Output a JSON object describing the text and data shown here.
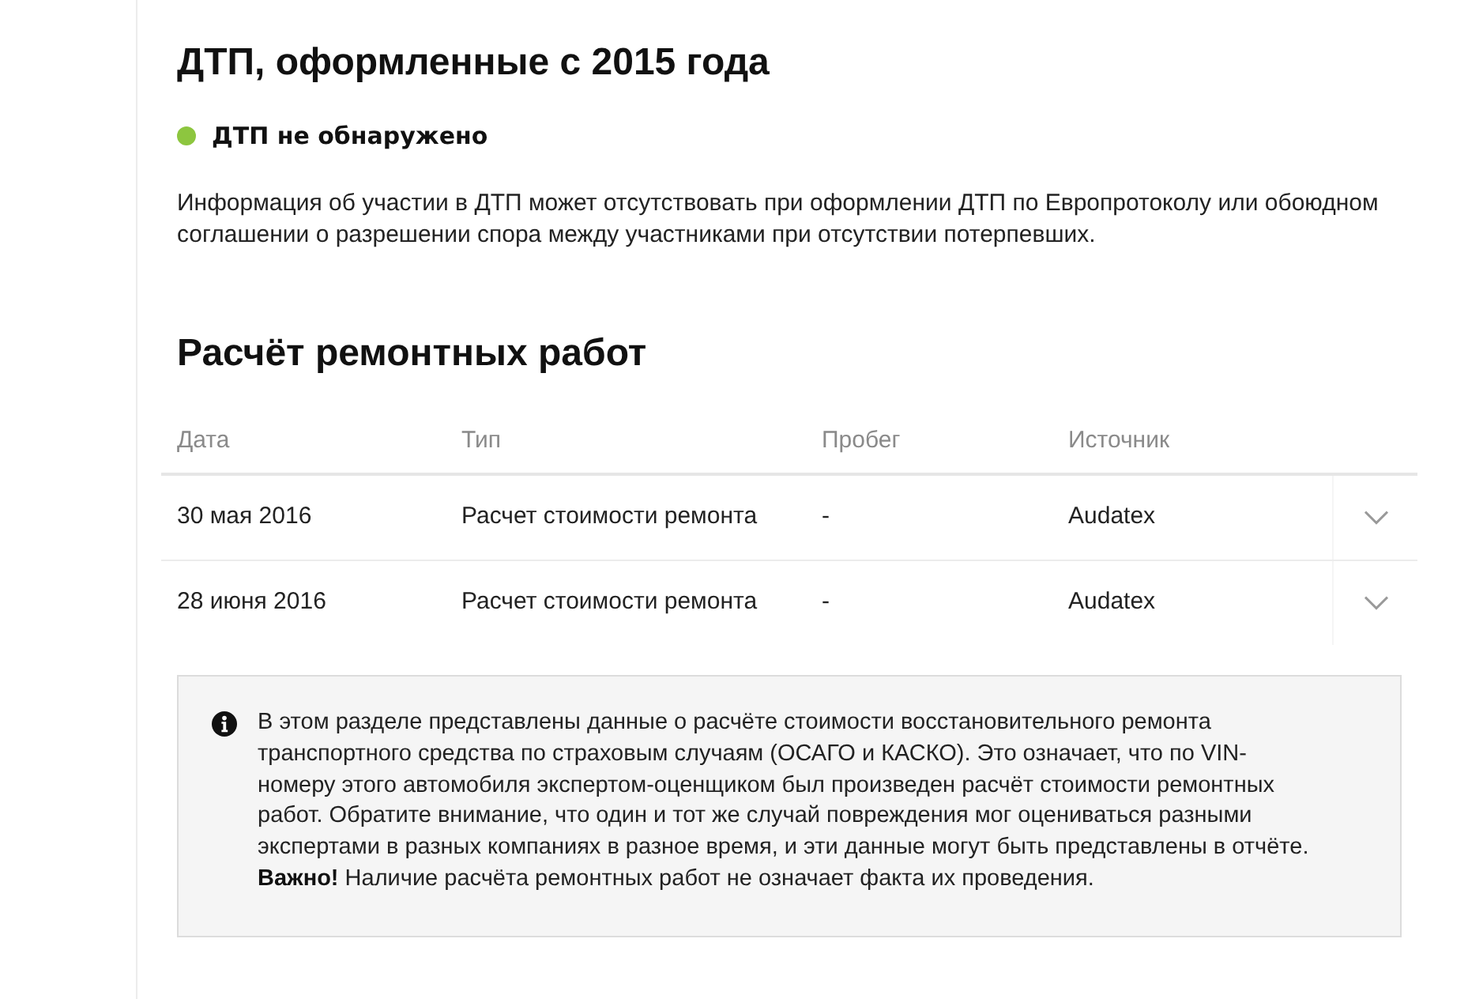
{
  "accidents": {
    "title": "ДТП, оформленные с 2015 года",
    "status": {
      "text": "ДТП не обнаружено",
      "found": false
    },
    "note": "Информация об участии в ДТП может отсутствовать при оформлении ДТП по Европротоколу или обоюдном соглашении о разрешении спора между участниками при отсутствии потерпевших."
  },
  "repairs": {
    "title": "Расчёт ремонтных работ",
    "table": {
      "columns": [
        "Дата",
        "Тип",
        "Пробег",
        "Источник"
      ],
      "rows": [
        {
          "cells": [
            "30 мая 2016",
            "Расчет стоимости ремонта",
            "-",
            "Audatex"
          ],
          "expanded": false
        },
        {
          "cells": [
            "28 июня 2016",
            "Расчет стоимости ремонта",
            "-",
            "Audatex"
          ],
          "expanded": false
        }
      ]
    },
    "info": "В этом разделе представлены данные о расчёте стоимости восстановительного ремонта транспортного средства по страховым случаям (ОСАГО и КАСКО). Это означает, что по VIN-номеру этого автомобиля экспертом-оценщиком был произведен расчёт стоимости ремонтных работ. Обратите внимание, что один и тот же случай повреждения мог оцениваться разными экспертами в разных компаниях в разное время, и эти данные могут быть представлены в отчёте. **Важно!** Наличие расчёта ремонтных работ не означает факта их проведения."
  }
}
